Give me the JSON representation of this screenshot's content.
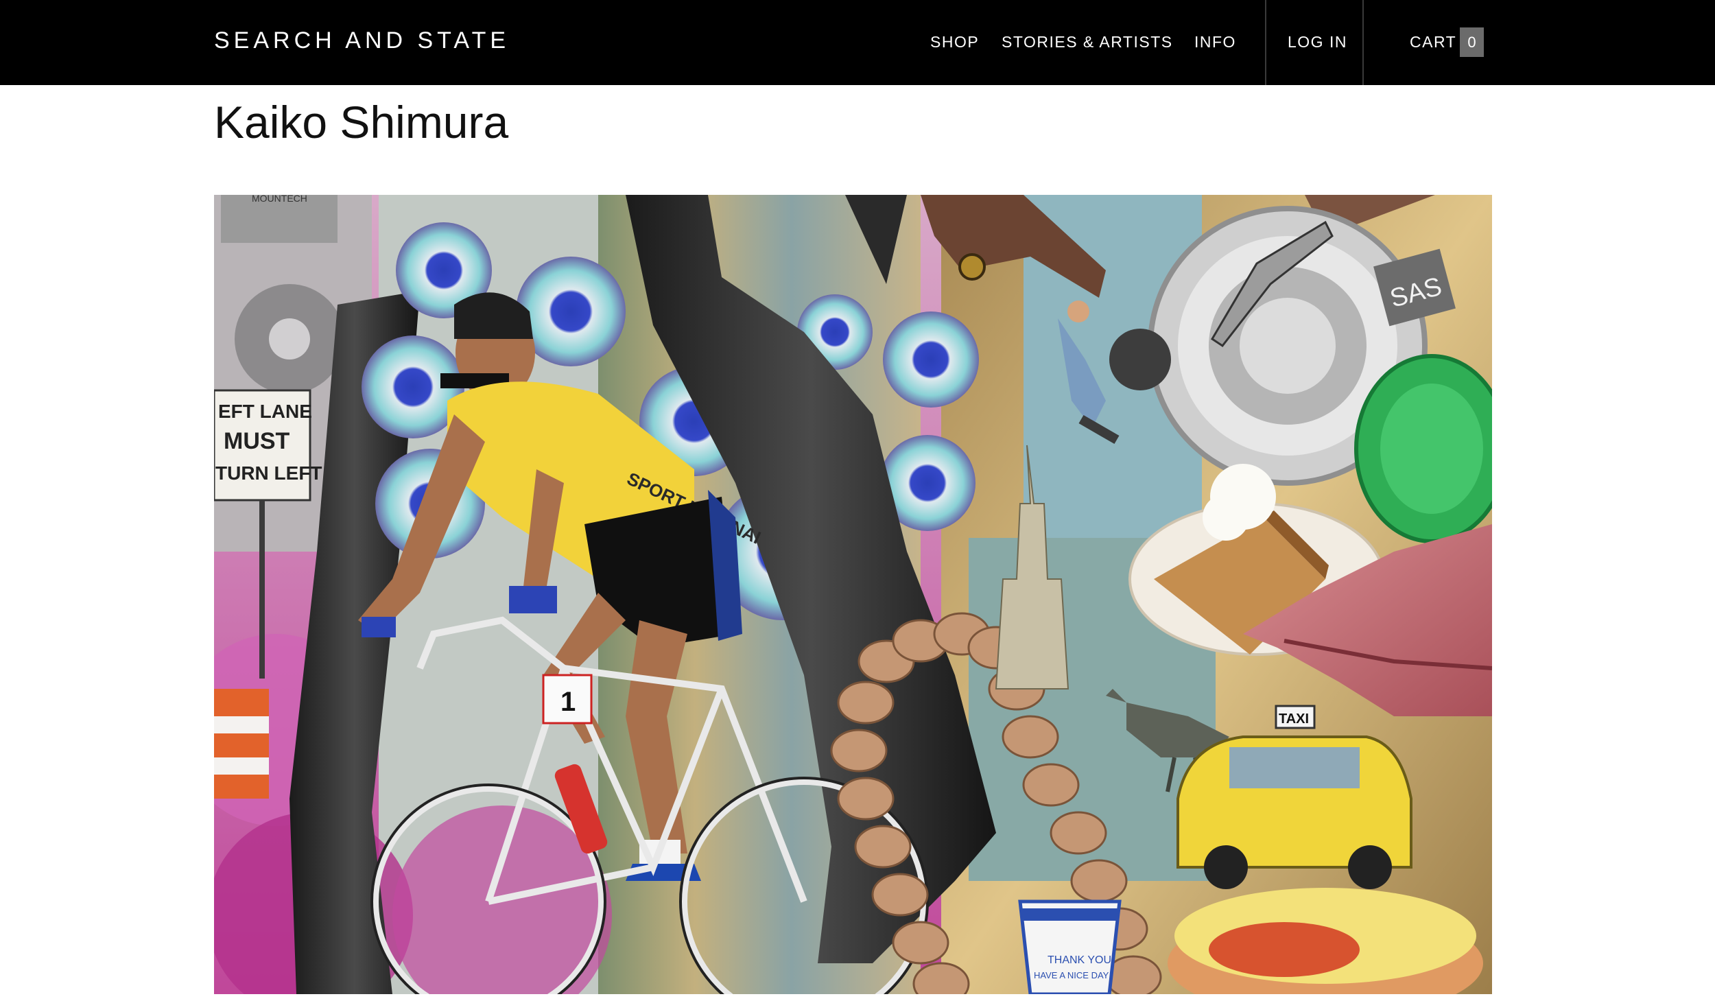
{
  "header": {
    "brand": "SEARCH AND STATE",
    "nav": {
      "shop": "SHOP",
      "stories_artists": "STORIES & ARTISTS",
      "info": "INFO"
    },
    "login": "LOG IN",
    "cart_label": "CART",
    "cart_count": "0"
  },
  "page": {
    "title": "Kaiko Shimura"
  },
  "artwork": {
    "sign_line1": "EFT LANE",
    "sign_line2": "MUST",
    "sign_line3": "TURN LEFT",
    "jersey_text": "SPORT LYONNAI",
    "brand_tag": "SAS",
    "taxi_sign": "TAXI",
    "cup_text": "THANK YOU",
    "cup_text2": "HAVE A NICE DAY",
    "bike_number": "1",
    "tape_text": "MOUNTECH"
  },
  "colors": {
    "header_bg": "#000000",
    "header_text": "#ffffff",
    "cart_badge": "#6b6b6b",
    "title_text": "#111111"
  }
}
